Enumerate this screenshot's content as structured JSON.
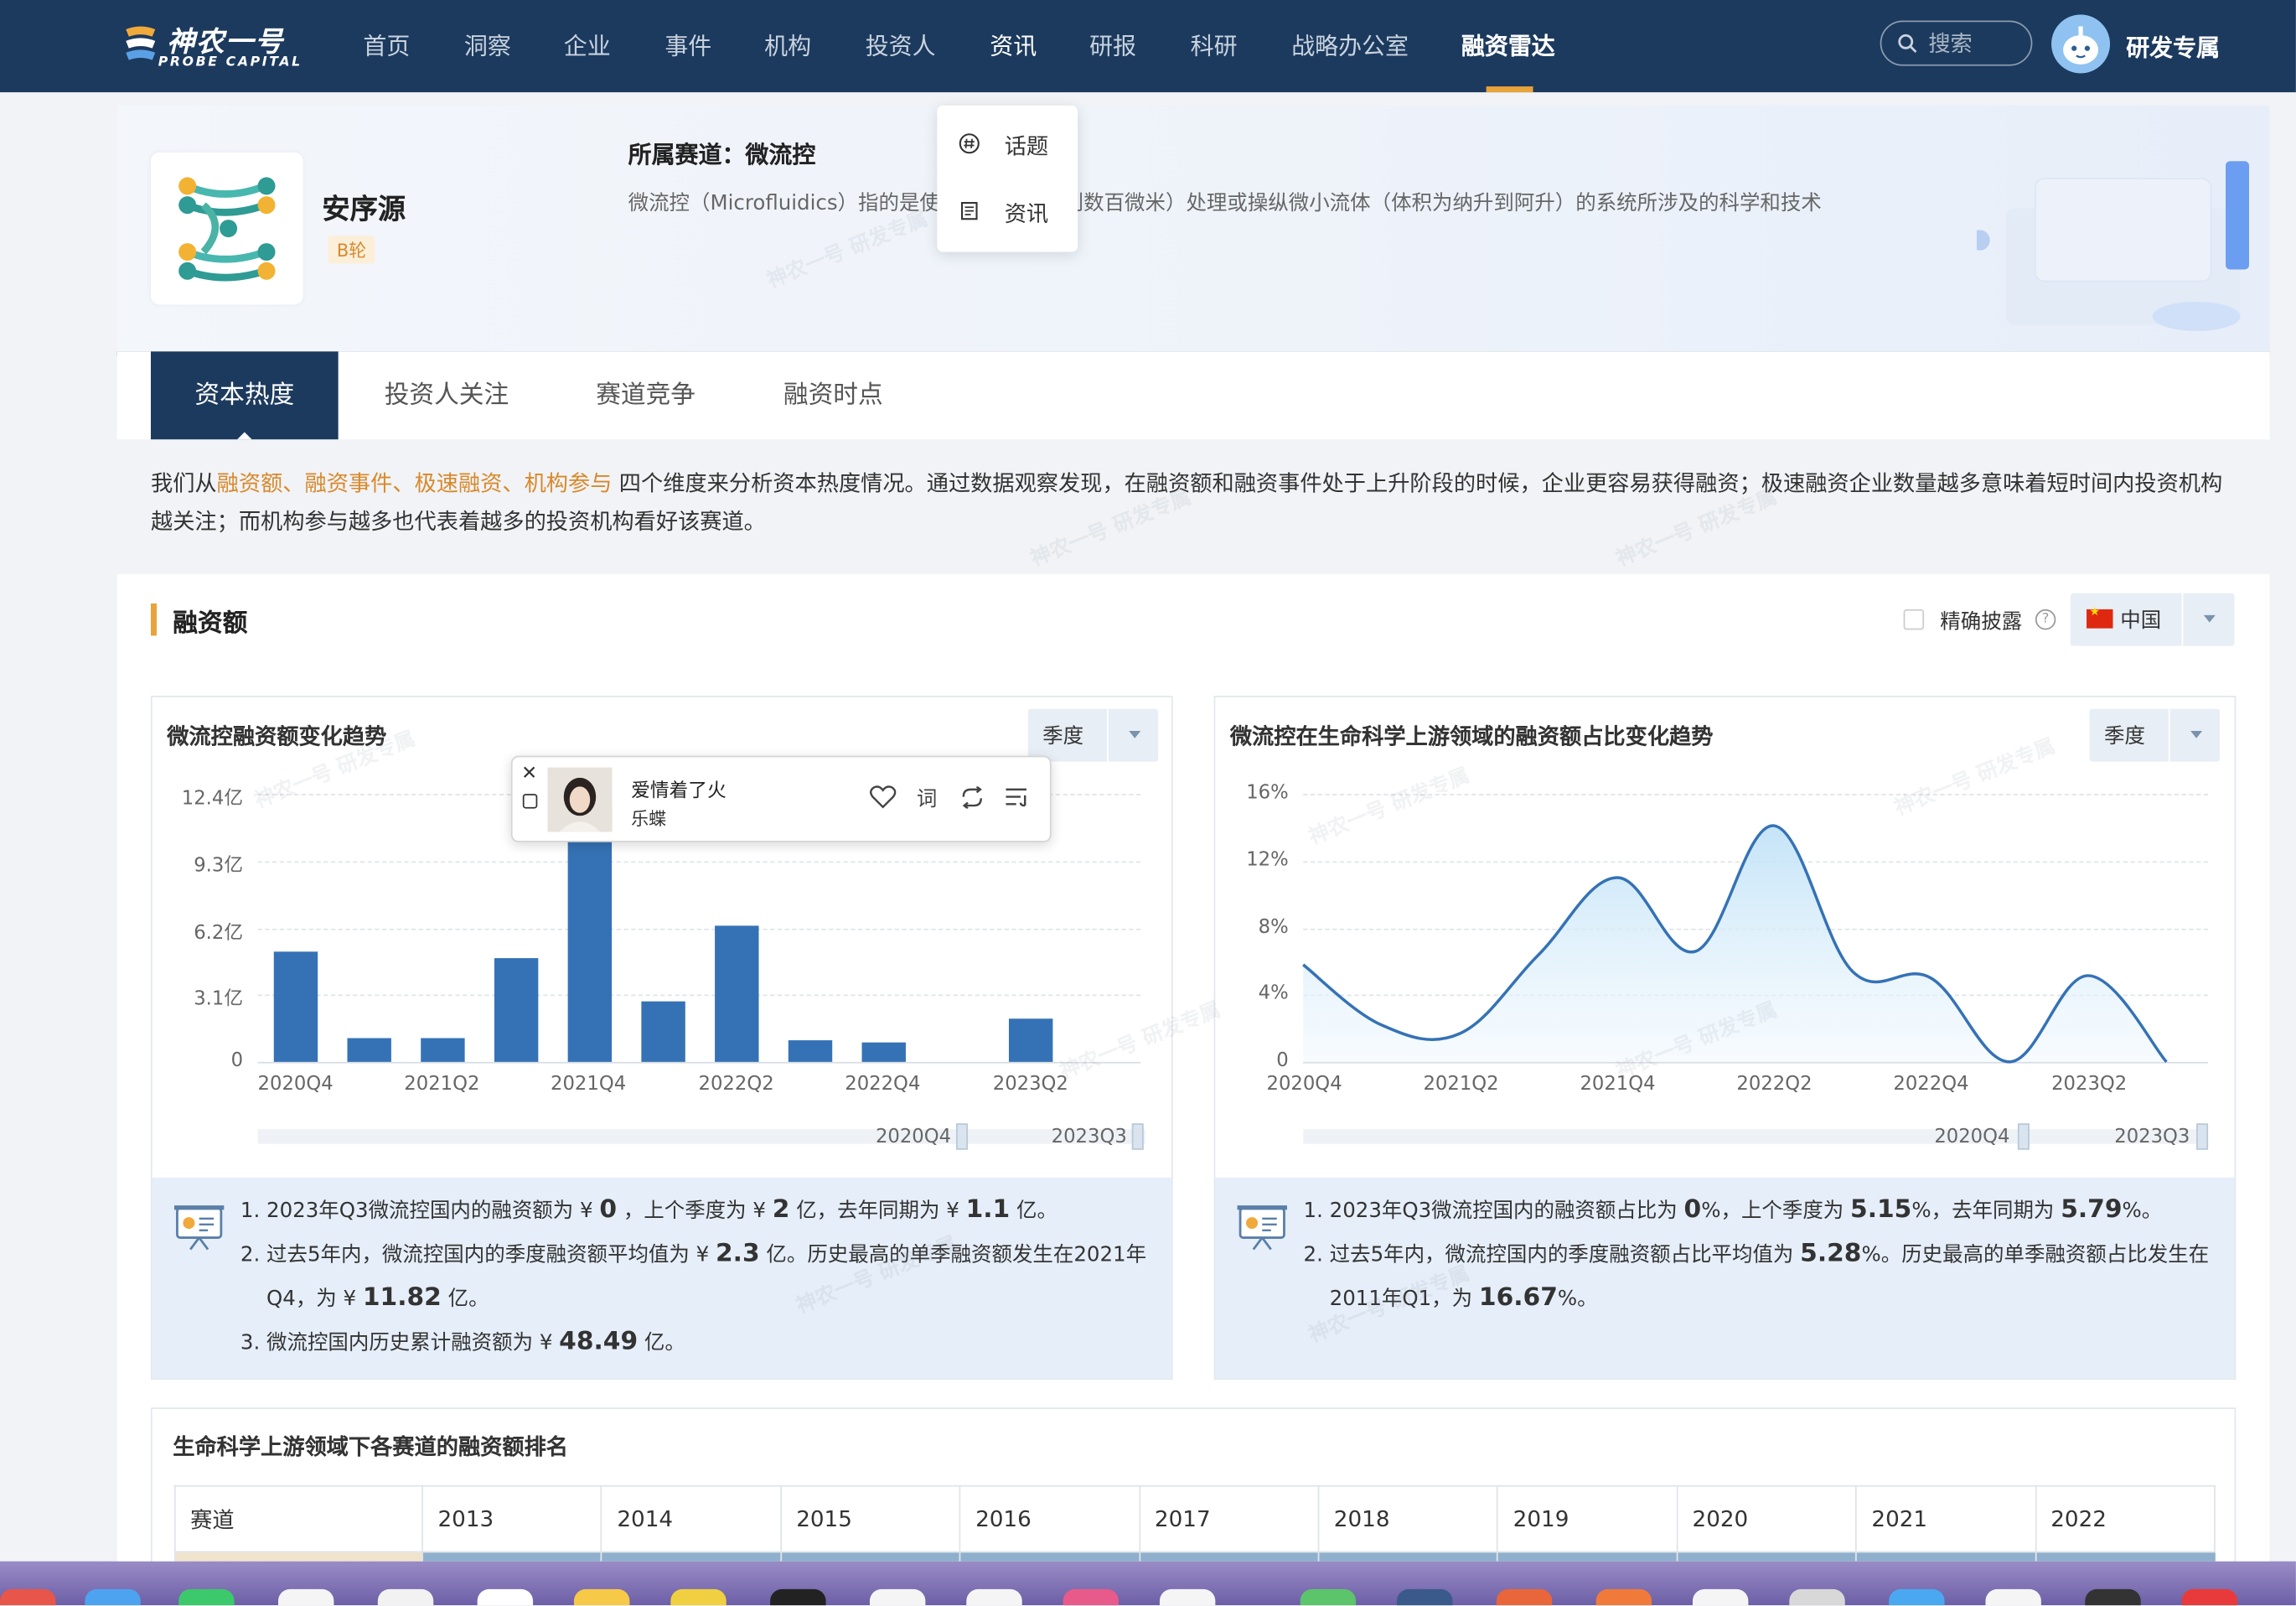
{
  "nav": {
    "logo_cn": "神农一号",
    "logo_en": "PROBE CAPITAL",
    "items": [
      {
        "label": "首页"
      },
      {
        "label": "洞察"
      },
      {
        "label": "企业"
      },
      {
        "label": "事件"
      },
      {
        "label": "机构"
      },
      {
        "label": "投资人"
      },
      {
        "label": "资讯"
      },
      {
        "label": "研报"
      },
      {
        "label": "科研"
      },
      {
        "label": "战略办公室"
      },
      {
        "label": "融资雷达"
      }
    ],
    "active_item": "融资雷达",
    "search_placeholder": "搜索",
    "user_name": "研发专属"
  },
  "dropdown": {
    "items": [
      {
        "label": "话题",
        "icon": "hash-icon"
      },
      {
        "label": "资讯",
        "icon": "document-icon"
      }
    ]
  },
  "company": {
    "name": "安序源",
    "round": "B轮",
    "track_label": "所属赛道：微流控",
    "track_desc": "微流控（Microfluidics）指的是使用尺寸为数十到数百微米）处理或操纵微小流体（体积为纳升到阿升）的系统所涉及的科学和技术"
  },
  "tabs": [
    {
      "label": "资本热度"
    },
    {
      "label": "投资人关注"
    },
    {
      "label": "赛道竞争"
    },
    {
      "label": "融资时点"
    }
  ],
  "intro": {
    "prefix": "我们从",
    "highlight": "融资额、融资事件、极速融资、机构参与",
    "suffix": " 四个维度来分析资本热度情况。通过数据观察发现，在融资额和融资事件处于上升阶段的时候，企业更容易获得融资；极速融资企业数量越多意味着短时间内投资机构越关注；而机构参与越多也代表着越多的投资机构看好该赛道。"
  },
  "section": {
    "title": "融资额",
    "precise_label": "精确披露",
    "help": "?",
    "country": "中国"
  },
  "chart_left": {
    "title": "微流控融资额变化趋势",
    "period": "季度",
    "y_ticks": [
      "12.4亿",
      "9.3亿",
      "6.2亿",
      "3.1亿",
      "0"
    ],
    "x_ticks": [
      "2020Q4",
      "2021Q2",
      "2021Q4",
      "2022Q2",
      "2022Q4",
      "2023Q2"
    ],
    "zoom_start": "2020Q4",
    "zoom_end": "2023Q3",
    "insights": {
      "i1_a": "2023年Q3微流控国内的融资额为 ¥ ",
      "i1_v1": "0",
      "i1_b": " ，上个季度为 ¥ ",
      "i1_v2": "2",
      "i1_c": " 亿，去年同期为 ¥ ",
      "i1_v3": "1.1",
      "i1_d": " 亿。",
      "i2_a": "过去5年内，微流控国内的季度融资额平均值为 ¥ ",
      "i2_v1": "2.3",
      "i2_b": " 亿。历史最高的单季融资额发生在2021年Q4，为 ¥ ",
      "i2_v2": "11.82",
      "i2_c": " 亿。",
      "i3_a": "微流控国内历史累计融资额为 ¥ ",
      "i3_v1": "48.49",
      "i3_b": " 亿。"
    }
  },
  "chart_right": {
    "title": "微流控在生命科学上游领域的融资额占比变化趋势",
    "period": "季度",
    "y_ticks": [
      "16%",
      "12%",
      "8%",
      "4%",
      "0"
    ],
    "x_ticks": [
      "2020Q4",
      "2021Q2",
      "2021Q4",
      "2022Q2",
      "2022Q4",
      "2023Q2"
    ],
    "zoom_start": "2020Q4",
    "zoom_end": "2023Q3",
    "insights": {
      "i1_a": "2023年Q3微流控国内的融资额占比为 ",
      "i1_v1": "0",
      "i1_b": "%，上个季度为 ",
      "i1_v2": "5.15",
      "i1_c": "%，去年同期为 ",
      "i1_v3": "5.79",
      "i1_d": "%。",
      "i2_a": "过去5年内，微流控国内的季度融资额占比平均值为 ",
      "i2_v1": "5.28",
      "i2_b": "%。历史最高的单季融资额占比发生在2011年Q1，为 ",
      "i2_v2": "16.67",
      "i2_c": "%。"
    }
  },
  "chart_data": [
    {
      "type": "bar",
      "categories": [
        "2020Q4",
        "2021Q1",
        "2021Q2",
        "2021Q3",
        "2021Q4",
        "2022Q1",
        "2022Q2",
        "2022Q3",
        "2022Q4",
        "2023Q1",
        "2023Q2",
        "2023Q3"
      ],
      "values": [
        5.1,
        1.1,
        1.1,
        4.8,
        11.82,
        2.8,
        6.3,
        1.0,
        0.9,
        0,
        2.0,
        0
      ],
      "unit": "亿",
      "ylim": [
        0,
        12.4
      ],
      "title": "微流控融资额变化趋势",
      "color": "#3572b5"
    },
    {
      "type": "area",
      "x": [
        "2020Q4",
        "2021Q1",
        "2021Q2",
        "2021Q3",
        "2021Q4",
        "2022Q1",
        "2022Q2",
        "2022Q3",
        "2022Q4",
        "2023Q1",
        "2023Q2",
        "2023Q3"
      ],
      "values": [
        5.8,
        2.2,
        1.7,
        6.4,
        11.0,
        6.6,
        14.1,
        5.4,
        5.0,
        0,
        5.15,
        0
      ],
      "unit": "%",
      "ylim": [
        0,
        16
      ],
      "title": "微流控在生命科学上游领域的融资额占比变化趋势",
      "color": "#3572b5"
    }
  ],
  "ranking": {
    "title": "生命科学上游领域下各赛道的融资额排名",
    "headers": [
      "赛道",
      "2013",
      "2014",
      "2015",
      "2016",
      "2017",
      "2018",
      "2019",
      "2020",
      "2021",
      "2022"
    ]
  },
  "music": {
    "song": "爱情着了火",
    "artist": "乐蝶",
    "lyrics": "词"
  },
  "watermark": "神农一号 研发专属"
}
